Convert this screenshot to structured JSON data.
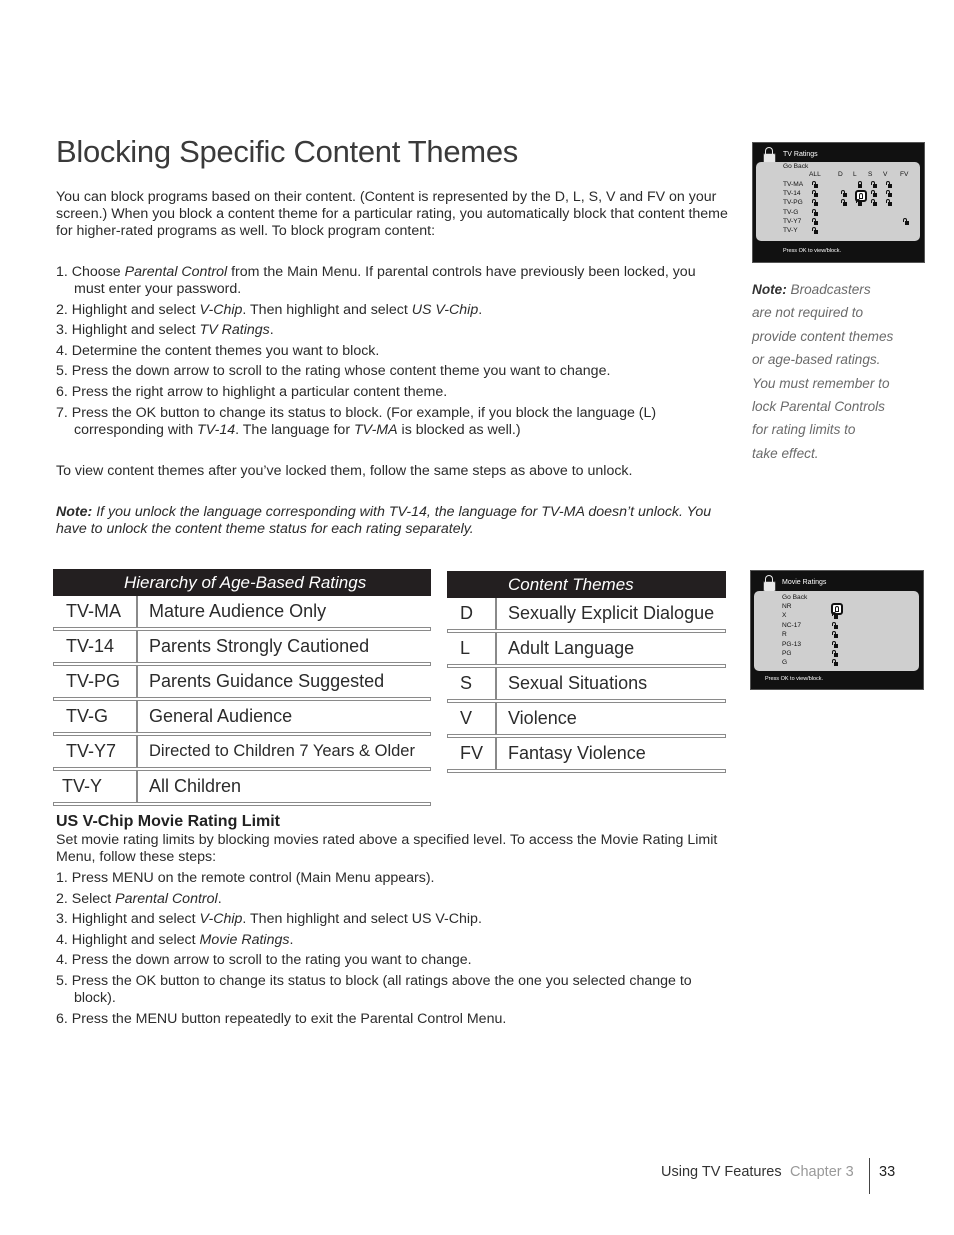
{
  "title": "Blocking Specific Content Themes",
  "intro": "You can block programs based on their content. (Content is represented by the D, L, S, V and FV on your screen.) When you block a content theme for a particular rating, you automatically block that content theme for higher-rated programs as well. To block program content:",
  "steps": [
    [
      {
        "t": "1. Choose "
      },
      {
        "t": "Parental Control",
        "i": true
      },
      {
        "t": " from the Main Menu. If parental controls have previously been locked, you must enter your password."
      }
    ],
    [
      {
        "t": "2. Highlight and select "
      },
      {
        "t": "V-Chip",
        "i": true
      },
      {
        "t": ". Then highlight and select "
      },
      {
        "t": "US V-Chip",
        "i": true
      },
      {
        "t": "."
      }
    ],
    [
      {
        "t": "3. Highlight and select "
      },
      {
        "t": "TV Ratings",
        "i": true
      },
      {
        "t": "."
      }
    ],
    [
      {
        "t": "4. Determine the content themes you want to block."
      }
    ],
    [
      {
        "t": "5. Press the down arrow to scroll to the rating whose content theme you want to change."
      }
    ],
    [
      {
        "t": "6. Press the right arrow to highlight a particular content theme."
      }
    ],
    [
      {
        "t": "7. Press the OK button to change its status to block. (For example, if you block the language (L) corresponding with "
      },
      {
        "t": "TV-14",
        "i": true
      },
      {
        "t": ". The language for "
      },
      {
        "t": "TV-MA",
        "i": true
      },
      {
        "t": " is blocked as well.)"
      }
    ]
  ],
  "unlock_text": "To view content themes after you’ve locked them, follow the same steps as above to unlock.",
  "note": {
    "label": "Note:",
    "text": " If you unlock the language corresponding with TV-14, the language for TV-MA doesn’t unlock. You have to unlock the content theme status for each rating separately."
  },
  "side_note": {
    "label": "Note:",
    "lines": [
      " Broadcasters",
      "are not required to",
      "provide content themes",
      "or age-based ratings.",
      "You must remember to",
      "lock Parental Controls",
      "for rating limits to",
      "take effect."
    ]
  },
  "ratings_table": {
    "header": "Hierarchy of Age-Based Ratings",
    "rows": [
      [
        "TV-MA",
        "Mature Audience Only"
      ],
      [
        "TV-14",
        "Parents Strongly Cautioned"
      ],
      [
        "TV-PG",
        "Parents Guidance Suggested"
      ],
      [
        "TV-G",
        "General Audience"
      ],
      [
        "TV-Y7",
        "Directed to Children 7 Years & Older"
      ],
      [
        "TV-Y",
        "All Children"
      ]
    ]
  },
  "themes_table": {
    "header": "Content Themes",
    "rows": [
      [
        "D",
        "Sexually Explicit Dialogue"
      ],
      [
        "L",
        "Adult Language"
      ],
      [
        "S",
        "Sexual Situations"
      ],
      [
        "V",
        "Violence"
      ],
      [
        "FV",
        "Fantasy Violence"
      ]
    ]
  },
  "tv_screen": {
    "title": "TV Ratings",
    "go_back": "Go Back",
    "footer": "Press OK to view/block.",
    "columns": [
      "ALL",
      "D",
      "L",
      "S",
      "V",
      "FV"
    ],
    "rows": [
      {
        "label": "TV-MA",
        "locks": [
          "unlocked",
          "",
          "locked",
          "unlocked",
          "unlocked",
          ""
        ]
      },
      {
        "label": "TV-14",
        "locks": [
          "unlocked",
          "unlocked",
          "selected",
          "unlocked",
          "unlocked",
          ""
        ]
      },
      {
        "label": "TV-PG",
        "locks": [
          "unlocked",
          "unlocked",
          "unlocked",
          "unlocked",
          "unlocked",
          ""
        ]
      },
      {
        "label": "TV-G",
        "locks": [
          "unlocked",
          "",
          "",
          "",
          "",
          ""
        ]
      },
      {
        "label": "TV-Y7",
        "locks": [
          "unlocked",
          "",
          "",
          "",
          "",
          "unlocked"
        ]
      },
      {
        "label": "TV-Y",
        "locks": [
          "unlocked",
          "",
          "",
          "",
          "",
          ""
        ]
      }
    ]
  },
  "movie_screen": {
    "title": "Movie Ratings",
    "go_back": "Go Back",
    "footer": "Press OK to view/block.",
    "rows": [
      {
        "label": "NR",
        "lock": "selected"
      },
      {
        "label": "X",
        "lock": "unlocked"
      },
      {
        "label": "NC-17",
        "lock": "unlocked"
      },
      {
        "label": "R",
        "lock": "unlocked"
      },
      {
        "label": "PG-13",
        "lock": "unlocked"
      },
      {
        "label": "PG",
        "lock": "unlocked"
      },
      {
        "label": "G",
        "lock": "unlocked"
      }
    ]
  },
  "movie_section": {
    "heading": "US V-Chip Movie Rating Limit",
    "intro": "Set movie rating limits by blocking movies rated above a specified level. To access the Movie Rating Limit Menu, follow these steps:",
    "steps": [
      [
        {
          "t": "1. Press MENU on the remote control (Main Menu appears)."
        }
      ],
      [
        {
          "t": "2. Select "
        },
        {
          "t": "Parental Control",
          "i": true
        },
        {
          "t": "."
        }
      ],
      [
        {
          "t": "3. Highlight and select "
        },
        {
          "t": "V-Chip",
          "i": true
        },
        {
          "t": ". Then highlight and select US V-Chip."
        }
      ],
      [
        {
          "t": "4. Highlight and select "
        },
        {
          "t": "Movie Ratings",
          "i": true
        },
        {
          "t": "."
        }
      ],
      [
        {
          "t": "4. Press the down arrow to scroll to the rating you want to change."
        }
      ],
      [
        {
          "t": "5. Press the OK button to change its status to block (all ratings above the one you selected change to block)."
        }
      ],
      [
        {
          "t": "6. Press the MENU button repeatedly to exit the Parental Control Menu."
        }
      ]
    ]
  },
  "footer": {
    "section": "Using TV Features",
    "chapter": "Chapter 3",
    "page": "33"
  }
}
